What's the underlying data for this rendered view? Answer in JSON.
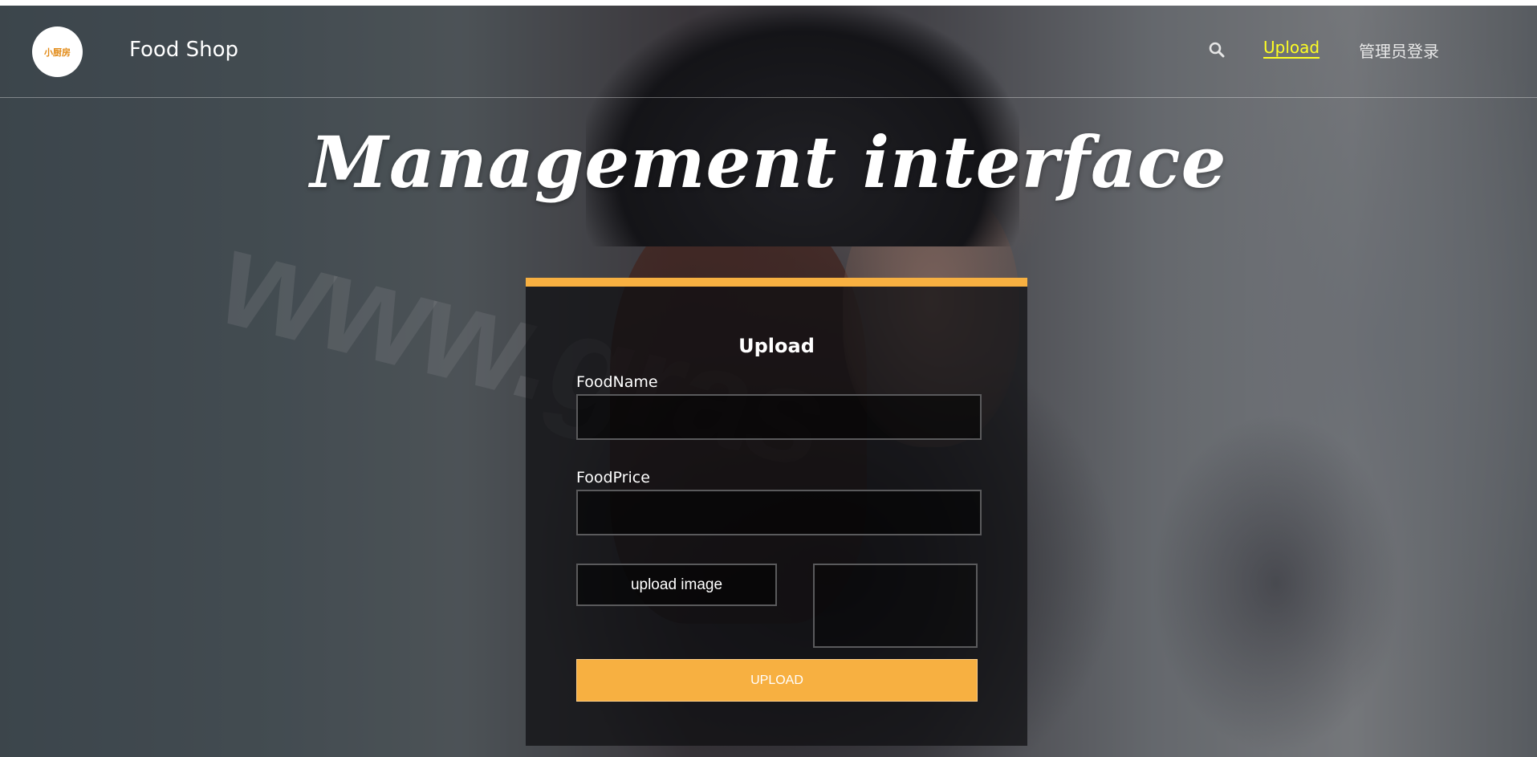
{
  "navbar": {
    "logo_text": "小厨房",
    "brand": "Food Shop",
    "search_icon": "search-icon",
    "links": {
      "upload": "Upload",
      "admin_login": "管理员登录"
    },
    "active_color": "#ffff22"
  },
  "hero": {
    "title": "Management interface"
  },
  "form": {
    "title": "Upload",
    "food_name_label": "FoodName",
    "food_name_value": "",
    "food_price_label": "FoodPrice",
    "food_price_value": "",
    "upload_image_label": "upload image",
    "submit_label": "UPLOAD",
    "accent_color": "#f7b041"
  },
  "background": {
    "watermark": "www.gras"
  }
}
